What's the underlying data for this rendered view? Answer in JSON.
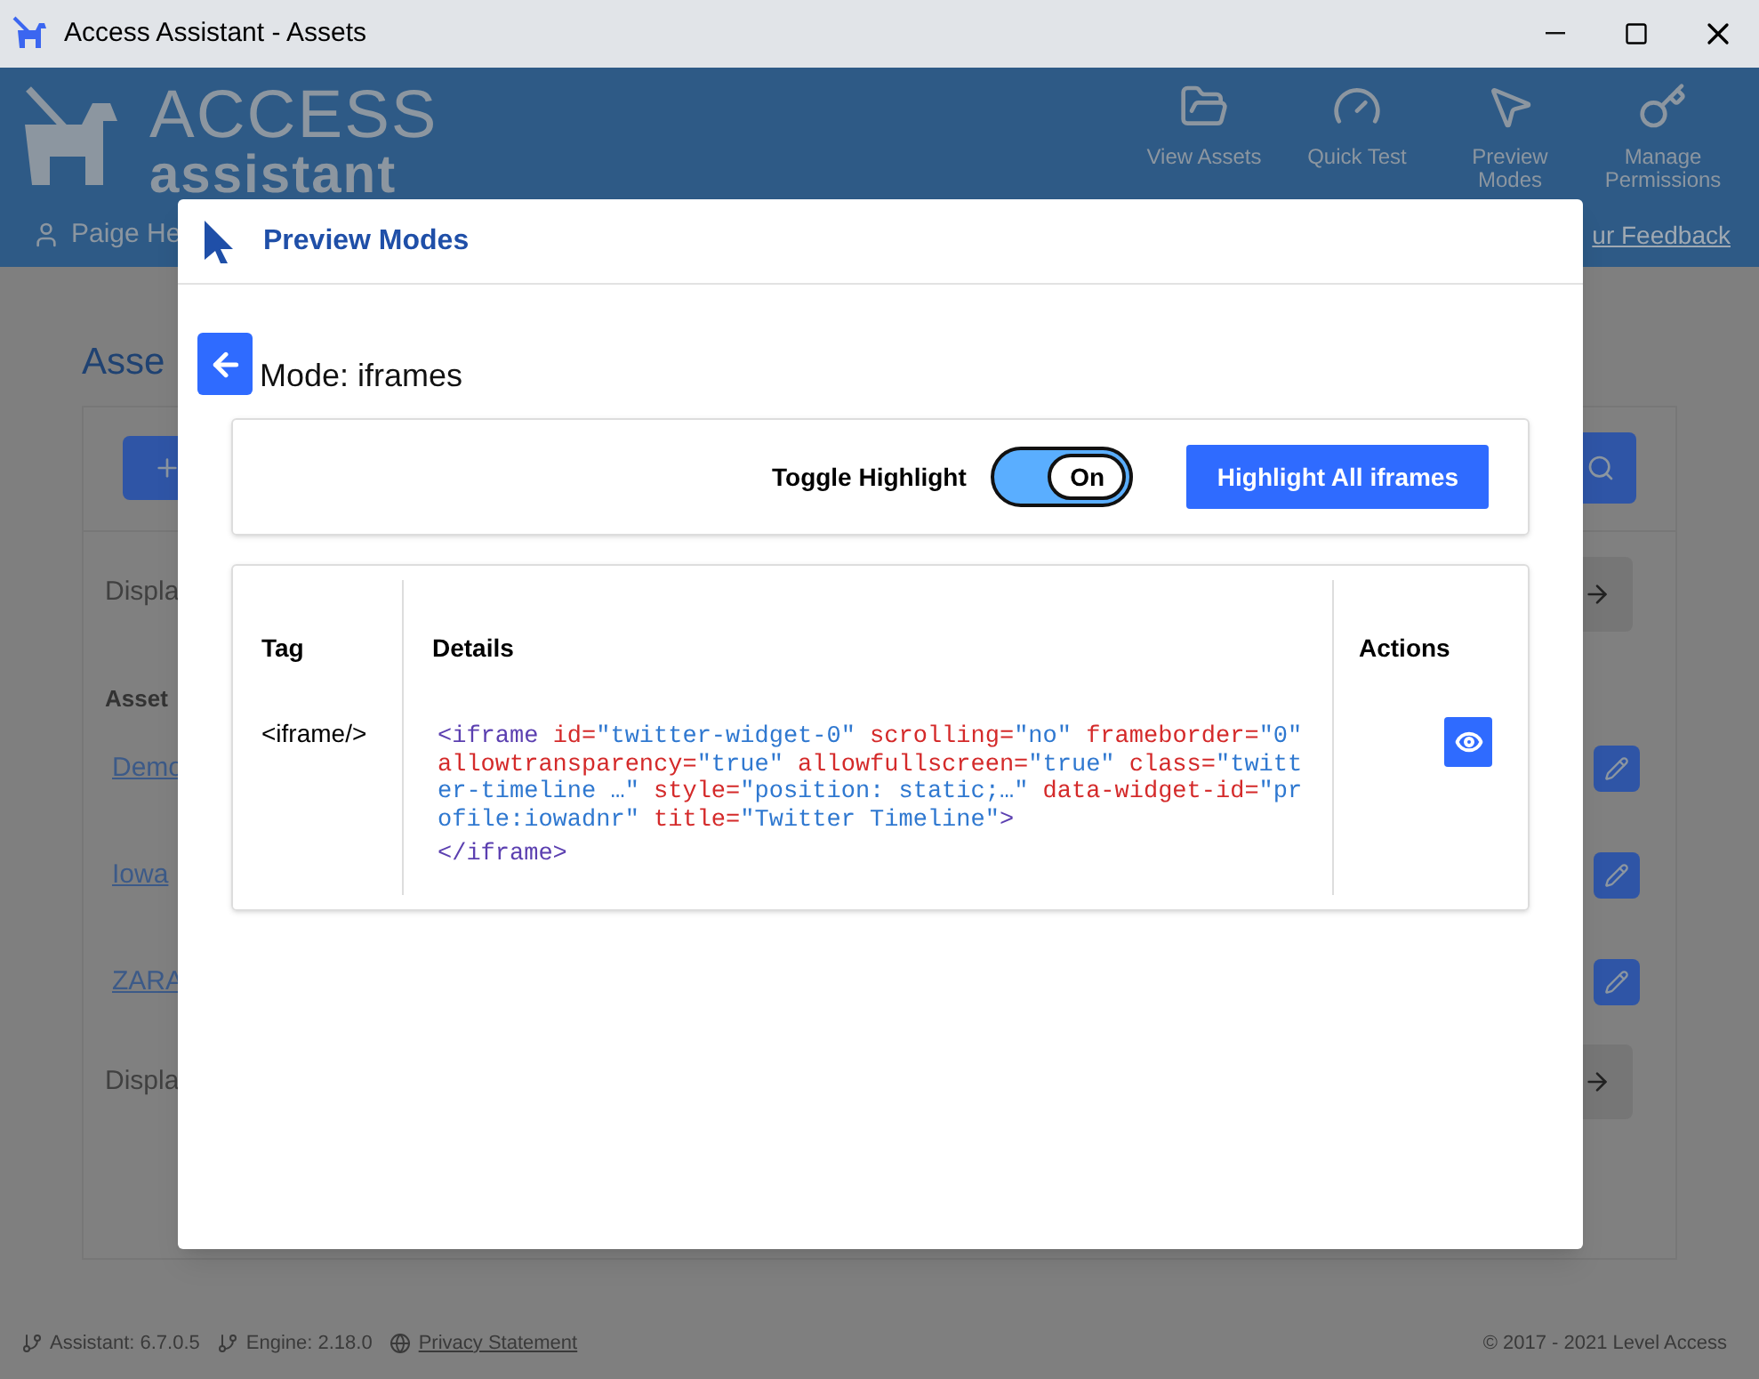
{
  "window": {
    "title": "Access Assistant - Assets"
  },
  "app_header": {
    "logo_top": "ACCESS",
    "logo_bottom": "assistant",
    "nav": [
      {
        "label": "View Assets"
      },
      {
        "label": "Quick Test"
      },
      {
        "label": "Preview Modes"
      },
      {
        "label": "Manage Permissions"
      }
    ],
    "user": "Paige He",
    "feedback": "ur Feedback"
  },
  "page": {
    "title": "Asse",
    "display_top": "Displa",
    "column": "Asset",
    "links": [
      "Demo",
      "Iowa",
      "ZARA"
    ],
    "display_bottom": "Displa"
  },
  "footer": {
    "assistant": "Assistant: 6.7.0.5",
    "engine": "Engine: 2.18.0",
    "privacy": "Privacy Statement",
    "copyright": "© 2017 - 2021 Level Access"
  },
  "dialog": {
    "title": "Preview Modes",
    "mode": "Mode: iframes",
    "toggle": {
      "label": "Toggle Highlight",
      "on": true,
      "state_text": "On"
    },
    "highlight_button": "Highlight All iframes",
    "table": {
      "columns": [
        "Tag",
        "Details",
        "Actions"
      ],
      "rows": [
        {
          "tag": "<iframe/>",
          "code": [
            {
              "text": "<iframe",
              "kind": "tag"
            },
            {
              "text": " id=",
              "kind": "attr"
            },
            {
              "text": "\"twitter-widget-0\"",
              "kind": "value"
            },
            {
              "text": " scrolling=",
              "kind": "attr"
            },
            {
              "text": "\"no\"",
              "kind": "value"
            },
            {
              "text": " frameborder=",
              "kind": "attr"
            },
            {
              "text": "\"0\"",
              "kind": "value"
            },
            {
              "text": " allowtransparency=",
              "kind": "attr"
            },
            {
              "text": "\"true\"",
              "kind": "value"
            },
            {
              "text": " allowfullscreen=",
              "kind": "attr"
            },
            {
              "text": "\"true\"",
              "kind": "value"
            },
            {
              "text": " class=",
              "kind": "attr"
            },
            {
              "text": "\"twitter-timeline …\"",
              "kind": "value"
            },
            {
              "text": " style=",
              "kind": "attr"
            },
            {
              "text": "\"position: static;…\"",
              "kind": "value"
            },
            {
              "text": " data-widget-id=",
              "kind": "attr"
            },
            {
              "text": "\"profile:iowadnr\"",
              "kind": "value"
            },
            {
              "text": " title=",
              "kind": "attr"
            },
            {
              "text": "\"Twitter Timeline\"",
              "kind": "value"
            },
            {
              "text": ">",
              "kind": "tag"
            }
          ],
          "closing": "</iframe>"
        }
      ]
    }
  }
}
